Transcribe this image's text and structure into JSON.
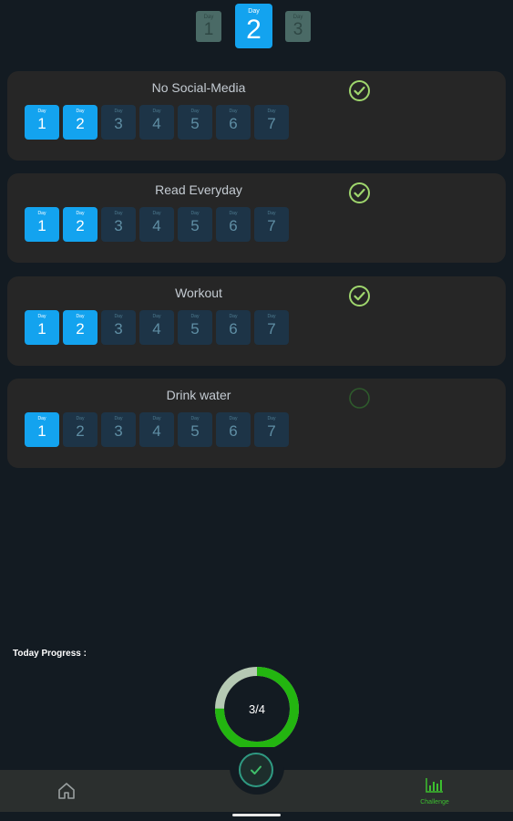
{
  "top_days": {
    "prev": {
      "label": "Day",
      "number": "1"
    },
    "current": {
      "label": "Day",
      "number": "2"
    },
    "next": {
      "label": "Day",
      "number": "3"
    }
  },
  "habits": [
    {
      "title": "No Social-Media",
      "completed_today": true,
      "days": [
        {
          "label": "Day",
          "number": "1",
          "done": true
        },
        {
          "label": "Day",
          "number": "2",
          "done": true
        },
        {
          "label": "Day",
          "number": "3",
          "done": false
        },
        {
          "label": "Day",
          "number": "4",
          "done": false
        },
        {
          "label": "Day",
          "number": "5",
          "done": false
        },
        {
          "label": "Day",
          "number": "6",
          "done": false
        },
        {
          "label": "Day",
          "number": "7",
          "done": false
        }
      ]
    },
    {
      "title": "Read Everyday",
      "completed_today": true,
      "days": [
        {
          "label": "Day",
          "number": "1",
          "done": true
        },
        {
          "label": "Day",
          "number": "2",
          "done": true
        },
        {
          "label": "Day",
          "number": "3",
          "done": false
        },
        {
          "label": "Day",
          "number": "4",
          "done": false
        },
        {
          "label": "Day",
          "number": "5",
          "done": false
        },
        {
          "label": "Day",
          "number": "6",
          "done": false
        },
        {
          "label": "Day",
          "number": "7",
          "done": false
        }
      ]
    },
    {
      "title": "Workout",
      "completed_today": true,
      "days": [
        {
          "label": "Day",
          "number": "1",
          "done": true
        },
        {
          "label": "Day",
          "number": "2",
          "done": true
        },
        {
          "label": "Day",
          "number": "3",
          "done": false
        },
        {
          "label": "Day",
          "number": "4",
          "done": false
        },
        {
          "label": "Day",
          "number": "5",
          "done": false
        },
        {
          "label": "Day",
          "number": "6",
          "done": false
        },
        {
          "label": "Day",
          "number": "7",
          "done": false
        }
      ]
    },
    {
      "title": "Drink water",
      "completed_today": false,
      "days": [
        {
          "label": "Day",
          "number": "1",
          "done": true
        },
        {
          "label": "Day",
          "number": "2",
          "done": false
        },
        {
          "label": "Day",
          "number": "3",
          "done": false
        },
        {
          "label": "Day",
          "number": "4",
          "done": false
        },
        {
          "label": "Day",
          "number": "5",
          "done": false
        },
        {
          "label": "Day",
          "number": "6",
          "done": false
        },
        {
          "label": "Day",
          "number": "7",
          "done": false
        }
      ]
    }
  ],
  "progress": {
    "label": "Today Progress :",
    "text": "3/4",
    "completed": 3,
    "total": 4
  },
  "bottom_nav": {
    "home_icon": "home-icon",
    "challenge_icon": "chart-icon",
    "challenge_label": "Challenge",
    "fab_icon": "check-icon"
  },
  "colors": {
    "background": "#131b22",
    "card": "#262626",
    "accent_blue": "#13a3ef",
    "day_inactive": "#1d3447",
    "check_green": "#9fd66d",
    "progress_green": "#23b510",
    "progress_track": "#b5c9b3",
    "nav_active": "#3cbf2f"
  }
}
